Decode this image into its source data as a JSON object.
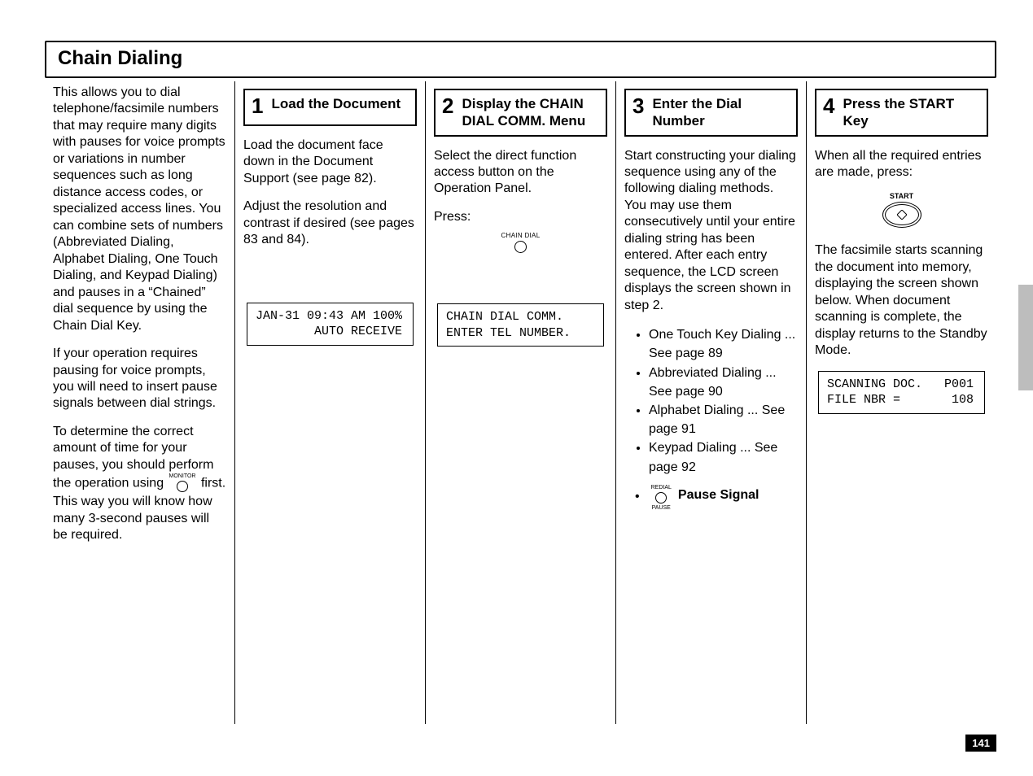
{
  "title": "Chain Dialing",
  "page_number": "141",
  "intro": {
    "p1": "This allows you to dial telephone/facsimile numbers that may require many digits with pauses for voice prompts or variations in number sequences such as long distance access codes, or specialized access lines. You can combine sets of numbers (Abbreviated Dialing, Alphabet Dialing, One Touch Dialing, and Keypad Dialing) and pauses in a “Chained” dial sequence by using the Chain Dial Key.",
    "p2": "If your operation requires pausing for voice prompts, you will need to insert pause signals between dial strings.",
    "p3a": "To determine the correct amount of time for your pauses, you should perform the operation using ",
    "p3b": " first. This way you will know how many 3-second pauses will be required.",
    "monitor_label": "MONITOR"
  },
  "step1": {
    "title": "Load the Document",
    "p1": "Load the document face down in the Document Support (see page 82).",
    "p2": "Adjust the resolution and contrast if desired (see pages 83 and 84).",
    "lcd": "JAN-31 09:43 AM 100%\n        AUTO RECEIVE"
  },
  "step2": {
    "title": "Display the CHAIN DIAL COMM. Menu",
    "p1": "Select the direct function access button on the Operation Panel.",
    "p2": "Press:",
    "btn_label": "CHAIN DIAL",
    "lcd": "CHAIN DIAL COMM.\nENTER TEL NUMBER."
  },
  "step3": {
    "title": "Enter the Dial Number",
    "p1": "Start constructing your dialing sequence using any of the following dialing methods. You may use them consecutively until your entire dialing string has been entered. After each entry sequence, the LCD screen displays the screen shown in step 2.",
    "items": [
      "One Touch Key Dialing ... See page 89",
      "Abbreviated Dialing ... See page 90",
      "Alphabet Dialing ... See page 91",
      "Keypad Dialing ... See page 92"
    ],
    "pause_top": "REDIAL",
    "pause_bottom": "PAUSE",
    "pause_label": "Pause Signal"
  },
  "step4": {
    "title": "Press the START Key",
    "p1": "When all the required entries are made, press:",
    "start_label": "START",
    "p2": "The facsimile starts scanning the document into memory, displaying the screen shown below. When document scanning is complete, the display returns to the Standby Mode.",
    "lcd": "SCANNING DOC.   P001\nFILE NBR =       108"
  }
}
